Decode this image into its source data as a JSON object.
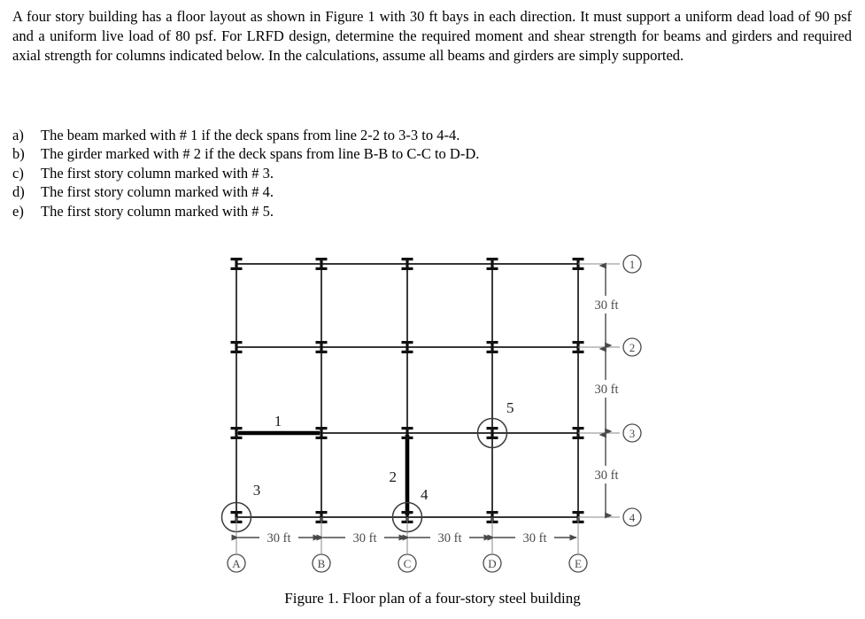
{
  "problem": {
    "statement": "A four story building has a floor layout as shown in Figure 1 with 30 ft bays in each direction. It must support a uniform dead load of 90 psf and a uniform live load of 80 psf. For LRFD design, determine the required moment and shear strength for beams and girders and required axial strength for columns indicated below. In the calculations, assume all beams and girders are simply supported.",
    "requirements": [
      {
        "marker": "a)",
        "text": "The beam marked with # 1 if the deck spans from line 2-2 to 3-3 to 4-4."
      },
      {
        "marker": "b)",
        "text": "The girder marked with # 2 if the deck spans from line B-B to C-C to D-D."
      },
      {
        "marker": "c)",
        "text": "The first story column marked with # 3."
      },
      {
        "marker": "d)",
        "text": "The first story column marked with # 4."
      },
      {
        "marker": "e)",
        "text": "The first story column marked with # 5."
      }
    ]
  },
  "figure": {
    "caption": "Figure 1. Floor plan of a four-story steel building",
    "column_grid_letters": [
      "A",
      "B",
      "C",
      "D",
      "E"
    ],
    "row_grid_numbers": [
      "1",
      "2",
      "3",
      "4"
    ],
    "horizontal_dimensions": [
      "30 ft",
      "30 ft",
      "30 ft",
      "30 ft"
    ],
    "vertical_dimensions": [
      "30 ft",
      "30 ft",
      "30 ft"
    ],
    "member_marks": [
      {
        "id": "1",
        "label": "1",
        "type": "beam",
        "orientation": "horizontal",
        "from": "A-3",
        "to": "B-3"
      },
      {
        "id": "2",
        "label": "2",
        "type": "girder",
        "orientation": "vertical",
        "from": "C-3",
        "to": "C-4"
      },
      {
        "id": "3",
        "label": "3",
        "type": "column",
        "at": "A-4"
      },
      {
        "id": "4",
        "label": "4",
        "type": "column",
        "at": "C-4"
      },
      {
        "id": "5",
        "label": "5",
        "type": "column",
        "at": "D-3"
      }
    ]
  },
  "chart_data": {
    "type": "diagram",
    "title": "Figure 1. Floor plan of a four-story steel building",
    "description": "Structural floor plan: 5 column lines (A-E) by 4 column lines (1-4), all bays 30 ft",
    "bay_width_ft": 30,
    "bay_depth_ft": 30,
    "num_bays_x": 4,
    "num_bays_y": 3,
    "grid_x_labels": [
      "A",
      "B",
      "C",
      "D",
      "E"
    ],
    "grid_y_labels": [
      "1",
      "2",
      "3",
      "4"
    ],
    "loads": {
      "dead_load_psf": 90,
      "live_load_psf": 80,
      "stories": 4
    },
    "marked_members": [
      {
        "mark": 1,
        "kind": "beam",
        "span_ft": 30
      },
      {
        "mark": 2,
        "kind": "girder",
        "span_ft": 30
      },
      {
        "mark": 3,
        "kind": "column",
        "position": "corner"
      },
      {
        "mark": 4,
        "kind": "column",
        "position": "edge"
      },
      {
        "mark": 5,
        "kind": "column",
        "position": "interior"
      }
    ]
  }
}
